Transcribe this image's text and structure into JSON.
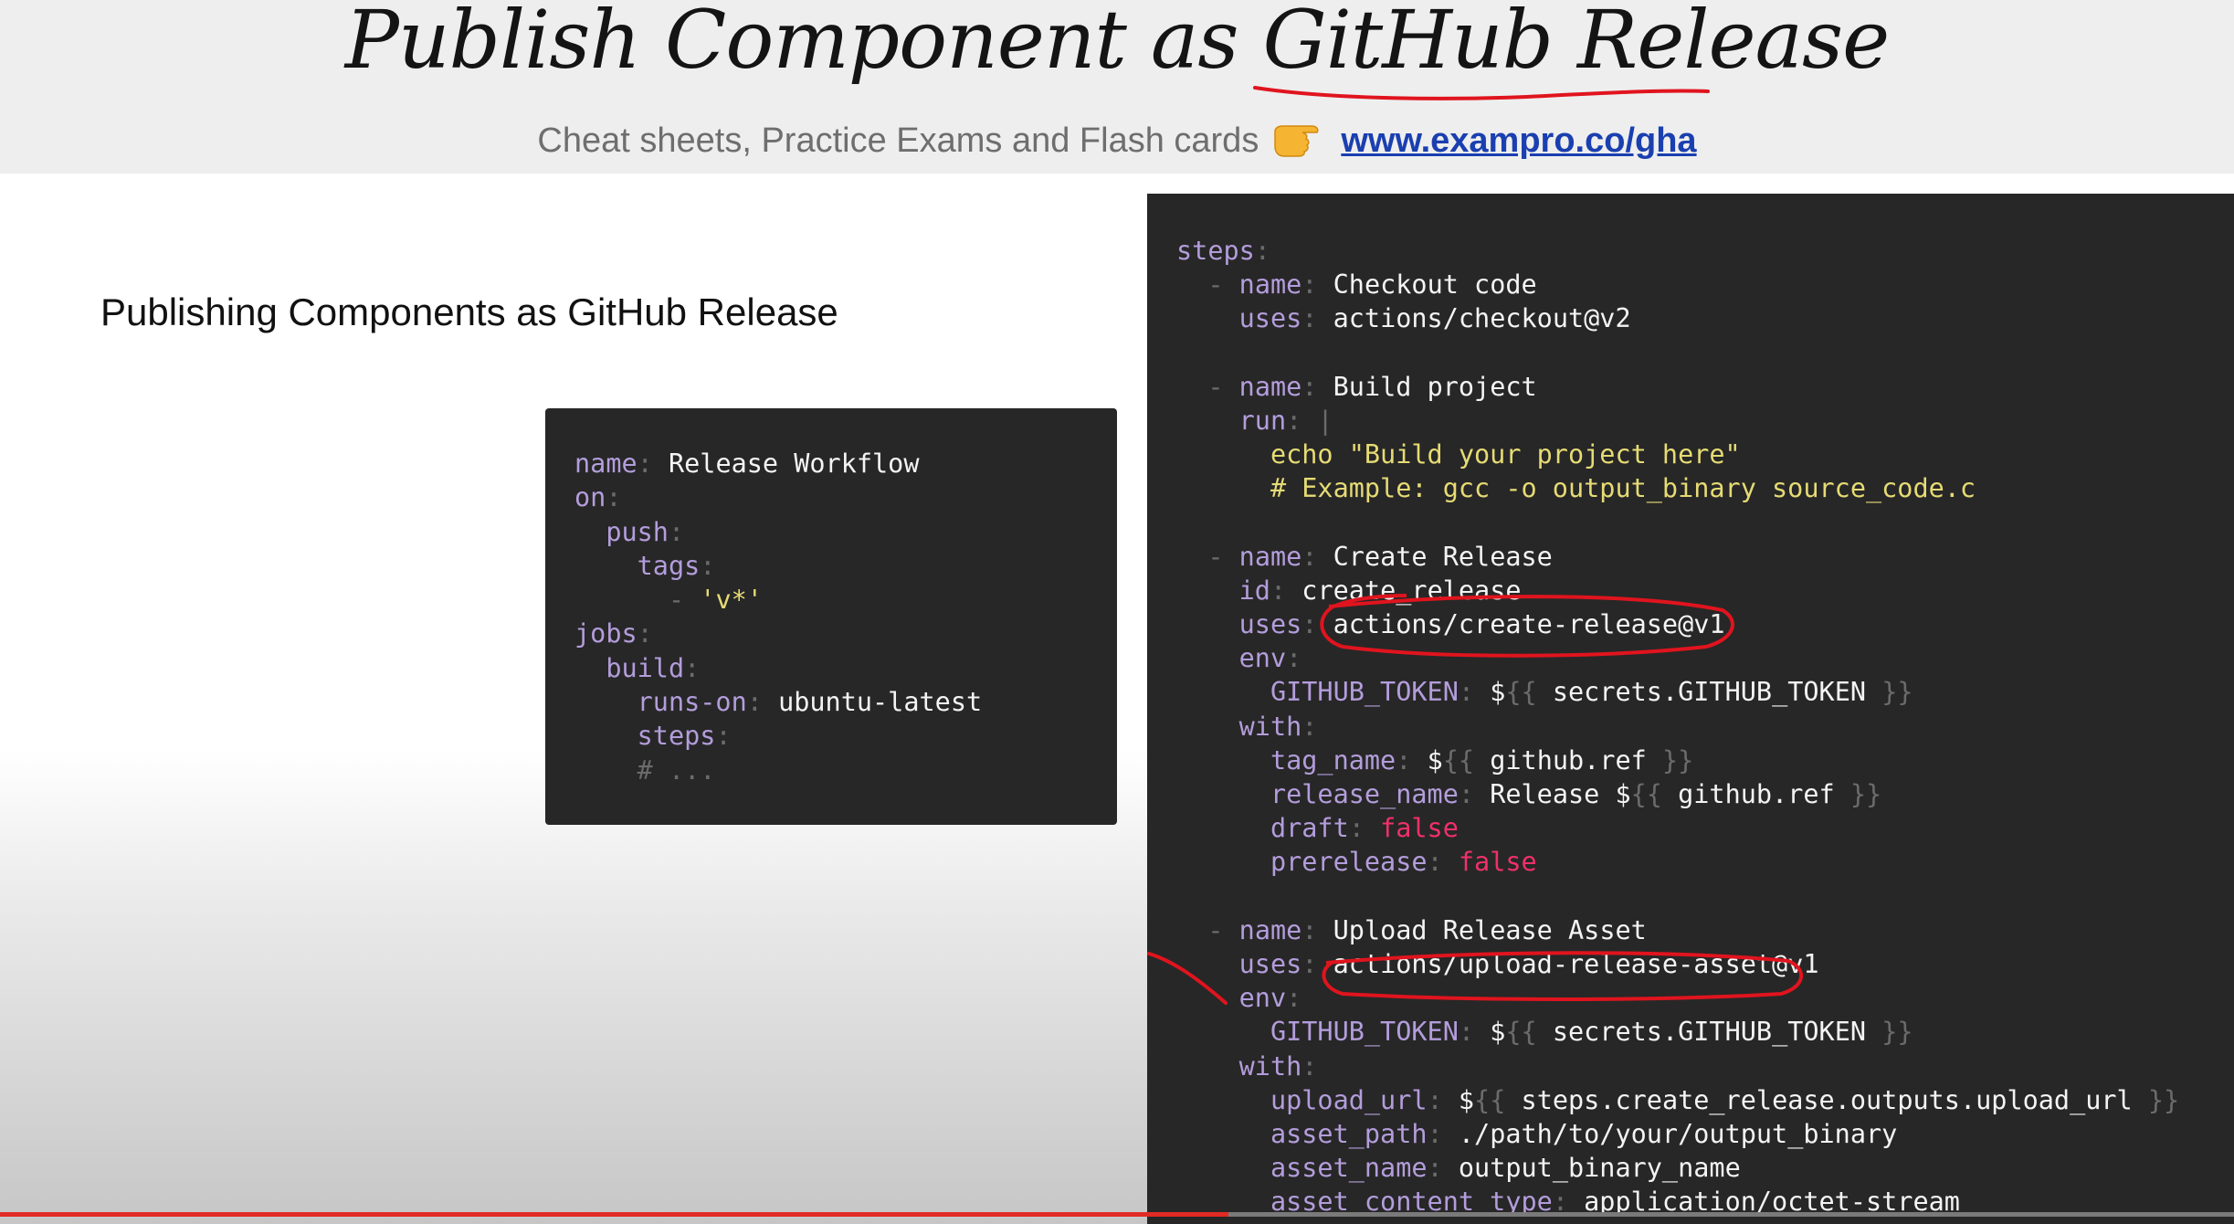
{
  "header": {
    "title": "Publish Component as GitHub Release",
    "subtitle": "Cheat sheets, Practice Exams and Flash cards",
    "pointer_icon": "pointing-hand-emoji",
    "link_text": "www.exampro.co/gha"
  },
  "section_heading": "Publishing Components as GitHub Release",
  "small_code": {
    "lines": [
      [
        {
          "t": "name",
          "c": "k"
        },
        {
          "t": ": ",
          "c": "p"
        },
        {
          "t": "Release Workflow",
          "c": "v"
        }
      ],
      [
        {
          "t": "on",
          "c": "k"
        },
        {
          "t": ":",
          "c": "p"
        }
      ],
      [
        {
          "t": "  "
        },
        {
          "t": "push",
          "c": "k"
        },
        {
          "t": ":",
          "c": "p"
        }
      ],
      [
        {
          "t": "    "
        },
        {
          "t": "tags",
          "c": "k"
        },
        {
          "t": ":",
          "c": "p"
        }
      ],
      [
        {
          "t": "      "
        },
        {
          "t": "- ",
          "c": "p"
        },
        {
          "t": "'v*'",
          "c": "s"
        }
      ],
      [
        {
          "t": "jobs",
          "c": "k"
        },
        {
          "t": ":",
          "c": "p"
        }
      ],
      [
        {
          "t": "  "
        },
        {
          "t": "build",
          "c": "k"
        },
        {
          "t": ":",
          "c": "p"
        }
      ],
      [
        {
          "t": "    "
        },
        {
          "t": "runs-on",
          "c": "k"
        },
        {
          "t": ": ",
          "c": "p"
        },
        {
          "t": "ubuntu-latest",
          "c": "v"
        }
      ],
      [
        {
          "t": "    "
        },
        {
          "t": "steps",
          "c": "k"
        },
        {
          "t": ":",
          "c": "p"
        }
      ],
      [
        {
          "t": "    "
        },
        {
          "t": "# ...",
          "c": "p"
        }
      ]
    ]
  },
  "big_code": {
    "lines": [
      [
        {
          "t": "steps",
          "c": "k"
        },
        {
          "t": ":",
          "c": "p"
        }
      ],
      [
        {
          "t": "  "
        },
        {
          "t": "- ",
          "c": "p"
        },
        {
          "t": "name",
          "c": "k"
        },
        {
          "t": ": ",
          "c": "p"
        },
        {
          "t": "Checkout code",
          "c": "v"
        }
      ],
      [
        {
          "t": "    "
        },
        {
          "t": "uses",
          "c": "k"
        },
        {
          "t": ": ",
          "c": "p"
        },
        {
          "t": "actions/checkout@v2",
          "c": "v"
        }
      ],
      [
        {
          "t": ""
        }
      ],
      [
        {
          "t": "  "
        },
        {
          "t": "- ",
          "c": "p"
        },
        {
          "t": "name",
          "c": "k"
        },
        {
          "t": ": ",
          "c": "p"
        },
        {
          "t": "Build project",
          "c": "v"
        }
      ],
      [
        {
          "t": "    "
        },
        {
          "t": "run",
          "c": "k"
        },
        {
          "t": ": ",
          "c": "p"
        },
        {
          "t": "|",
          "c": "p"
        }
      ],
      [
        {
          "t": "      "
        },
        {
          "t": "echo \"Build your project here\"",
          "c": "s"
        }
      ],
      [
        {
          "t": "      "
        },
        {
          "t": "# Example: gcc -o output_binary source_code.c",
          "c": "s"
        }
      ],
      [
        {
          "t": ""
        }
      ],
      [
        {
          "t": "  "
        },
        {
          "t": "- ",
          "c": "p"
        },
        {
          "t": "name",
          "c": "k"
        },
        {
          "t": ": ",
          "c": "p"
        },
        {
          "t": "Create Release",
          "c": "v"
        }
      ],
      [
        {
          "t": "    "
        },
        {
          "t": "id",
          "c": "k"
        },
        {
          "t": ": ",
          "c": "p"
        },
        {
          "t": "create_release",
          "c": "v"
        }
      ],
      [
        {
          "t": "    "
        },
        {
          "t": "uses",
          "c": "k"
        },
        {
          "t": ": ",
          "c": "p"
        },
        {
          "t": "actions/create-release@v1",
          "c": "v"
        }
      ],
      [
        {
          "t": "    "
        },
        {
          "t": "env",
          "c": "k"
        },
        {
          "t": ":",
          "c": "p"
        }
      ],
      [
        {
          "t": "      "
        },
        {
          "t": "GITHUB_TOKEN",
          "c": "k"
        },
        {
          "t": ": ",
          "c": "p"
        },
        {
          "t": "$",
          "c": "v"
        },
        {
          "t": "{{",
          "c": "p"
        },
        {
          "t": " secrets.GITHUB_TOKEN ",
          "c": "v"
        },
        {
          "t": "}}",
          "c": "p"
        }
      ],
      [
        {
          "t": "    "
        },
        {
          "t": "with",
          "c": "k"
        },
        {
          "t": ":",
          "c": "p"
        }
      ],
      [
        {
          "t": "      "
        },
        {
          "t": "tag_name",
          "c": "k"
        },
        {
          "t": ": ",
          "c": "p"
        },
        {
          "t": "$",
          "c": "v"
        },
        {
          "t": "{{",
          "c": "p"
        },
        {
          "t": " github.ref ",
          "c": "v"
        },
        {
          "t": "}}",
          "c": "p"
        }
      ],
      [
        {
          "t": "      "
        },
        {
          "t": "release_name",
          "c": "k"
        },
        {
          "t": ": ",
          "c": "p"
        },
        {
          "t": "Release $",
          "c": "v"
        },
        {
          "t": "{{",
          "c": "p"
        },
        {
          "t": " github.ref ",
          "c": "v"
        },
        {
          "t": "}}",
          "c": "p"
        }
      ],
      [
        {
          "t": "      "
        },
        {
          "t": "draft",
          "c": "k"
        },
        {
          "t": ": ",
          "c": "p"
        },
        {
          "t": "false",
          "c": "f"
        }
      ],
      [
        {
          "t": "      "
        },
        {
          "t": "prerelease",
          "c": "k"
        },
        {
          "t": ": ",
          "c": "p"
        },
        {
          "t": "false",
          "c": "f"
        }
      ],
      [
        {
          "t": ""
        }
      ],
      [
        {
          "t": "  "
        },
        {
          "t": "- ",
          "c": "p"
        },
        {
          "t": "name",
          "c": "k"
        },
        {
          "t": ": ",
          "c": "p"
        },
        {
          "t": "Upload Release Asset",
          "c": "v"
        }
      ],
      [
        {
          "t": "    "
        },
        {
          "t": "uses",
          "c": "k"
        },
        {
          "t": ": ",
          "c": "p"
        },
        {
          "t": "actions/upload-release-asset@v1",
          "c": "v"
        }
      ],
      [
        {
          "t": "    "
        },
        {
          "t": "env",
          "c": "k"
        },
        {
          "t": ":",
          "c": "p"
        }
      ],
      [
        {
          "t": "      "
        },
        {
          "t": "GITHUB_TOKEN",
          "c": "k"
        },
        {
          "t": ": ",
          "c": "p"
        },
        {
          "t": "$",
          "c": "v"
        },
        {
          "t": "{{",
          "c": "p"
        },
        {
          "t": " secrets.GITHUB_TOKEN ",
          "c": "v"
        },
        {
          "t": "}}",
          "c": "p"
        }
      ],
      [
        {
          "t": "    "
        },
        {
          "t": "with",
          "c": "k"
        },
        {
          "t": ":",
          "c": "p"
        }
      ],
      [
        {
          "t": "      "
        },
        {
          "t": "upload_url",
          "c": "k"
        },
        {
          "t": ": ",
          "c": "p"
        },
        {
          "t": "$",
          "c": "v"
        },
        {
          "t": "{{",
          "c": "p"
        },
        {
          "t": " steps.create_release.outputs.upload_url ",
          "c": "v"
        },
        {
          "t": "}}",
          "c": "p"
        }
      ],
      [
        {
          "t": "      "
        },
        {
          "t": "asset_path",
          "c": "k"
        },
        {
          "t": ": ",
          "c": "p"
        },
        {
          "t": "./path/to/your/output_binary",
          "c": "v"
        }
      ],
      [
        {
          "t": "      "
        },
        {
          "t": "asset_name",
          "c": "k"
        },
        {
          "t": ": ",
          "c": "p"
        },
        {
          "t": "output_binary_name",
          "c": "v"
        }
      ],
      [
        {
          "t": "      "
        },
        {
          "t": "asset_content_type",
          "c": "k"
        },
        {
          "t": ": ",
          "c": "p"
        },
        {
          "t": "application/octet-stream",
          "c": "v"
        }
      ]
    ]
  },
  "colors": {
    "code_background": "#272727",
    "key": "#b39ddb",
    "string": "#e6db74",
    "boolean": "#f0306a",
    "annotation": "#e0141e",
    "link": "#1a3fb0"
  },
  "video": {
    "progress": 0.55
  }
}
